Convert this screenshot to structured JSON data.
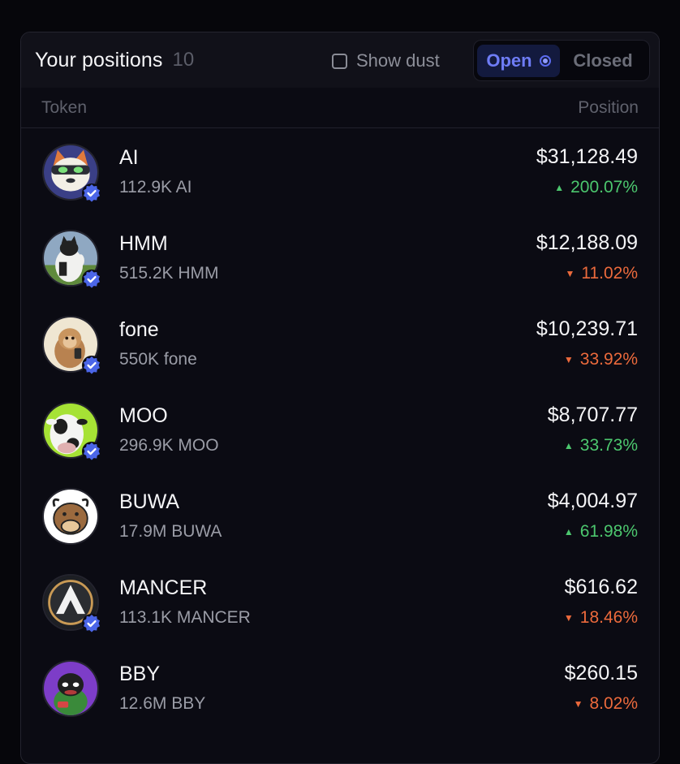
{
  "header": {
    "title": "Your positions",
    "count": "10",
    "show_dust_label": "Show dust",
    "tabs": {
      "open": "Open",
      "closed": "Closed"
    }
  },
  "columns": {
    "token": "Token",
    "position": "Position"
  },
  "colors": {
    "up": "#4cc76e",
    "down": "#ec6a3c",
    "accent": "#6e7cf5"
  },
  "positions": [
    {
      "symbol": "AI",
      "amount": "112.9K AI",
      "value": "$31,128.49",
      "change": "200.07%",
      "direction": "up",
      "verified": true,
      "avatar": "cat-icon"
    },
    {
      "symbol": "HMM",
      "amount": "515.2K HMM",
      "value": "$12,188.09",
      "change": "11.02%",
      "direction": "down",
      "verified": true,
      "avatar": "cat-photo-icon"
    },
    {
      "symbol": "fone",
      "amount": "550K fone",
      "value": "$10,239.71",
      "change": "33.92%",
      "direction": "down",
      "verified": true,
      "avatar": "monkey-icon"
    },
    {
      "symbol": "MOO",
      "amount": "296.9K MOO",
      "value": "$8,707.77",
      "change": "33.73%",
      "direction": "up",
      "verified": true,
      "avatar": "cow-icon"
    },
    {
      "symbol": "BUWA",
      "amount": "17.9M BUWA",
      "value": "$4,004.97",
      "change": "61.98%",
      "direction": "up",
      "verified": false,
      "avatar": "buffalo-icon"
    },
    {
      "symbol": "MANCER",
      "amount": "113.1K MANCER",
      "value": "$616.62",
      "change": "18.46%",
      "direction": "down",
      "verified": true,
      "avatar": "mancer-logo-icon"
    },
    {
      "symbol": "BBY",
      "amount": "12.6M BBY",
      "value": "$260.15",
      "change": "8.02%",
      "direction": "down",
      "verified": false,
      "avatar": "frog-icon"
    }
  ]
}
